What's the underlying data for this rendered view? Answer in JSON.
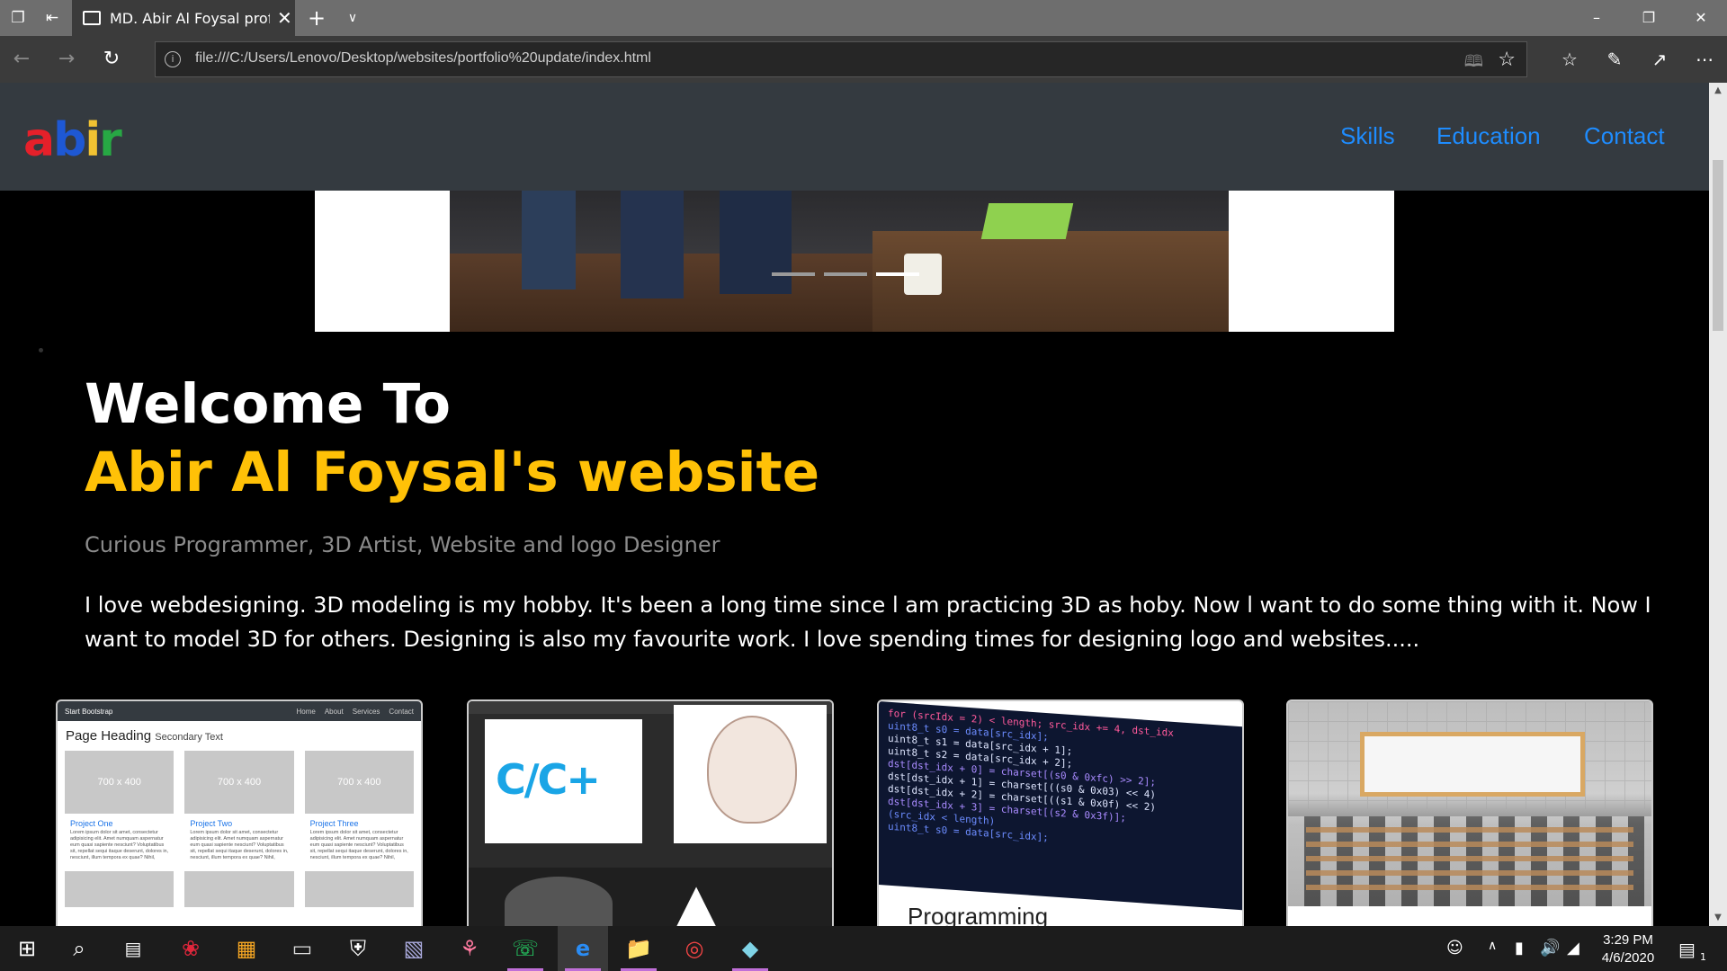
{
  "browser": {
    "tab_title": "MD. Abir Al Foysal profi",
    "url": "file:///C:/Users/Lenovo/Desktop/websites/portfolio%20update/index.html"
  },
  "site": {
    "logo_letters": [
      "a",
      "b",
      "i",
      "r"
    ],
    "nav": [
      "Skills",
      "Education",
      "Contact"
    ],
    "carousel": {
      "slide_count": 3,
      "active_slide": 3
    },
    "welcome": "Welcome To",
    "name": "Abir Al Foysal's website",
    "tagline": "Curious Programmer, 3D Artist, Website and logo Designer",
    "about": "I love webdesigning. 3D modeling is my hobby. It's been a long time since l am practicing 3D as hoby. Now l want to do some thing with it. Now I want to model 3D for others. Designing is also my favourite work. I love spending times for designing logo and websites.....",
    "cards": {
      "bootstrap": {
        "brand": "Start Bootstrap",
        "links": [
          "Home",
          "About",
          "Services",
          "Contact"
        ],
        "heading": "Page Heading",
        "subheading": "Secondary Text",
        "placeholder": "700 x 400",
        "projects": [
          "Project One",
          "Project Two",
          "Project Three"
        ],
        "lorem": "Lorem ipsum dolor sit amet, consectetur adipisicing elit. Amet numquam aspernatur eum quasi sapiente nesciunt? Voluptatibus sit, repellat sequi itaque deserunt, dolores in, nesciunt, illum tempora ex quae? Nihil, dolorem!"
      },
      "design": {
        "logo_text": "C/C+"
      },
      "code": {
        "lines": [
          "for (srcIdx = 2) < length; src_idx += 4, dst_idx",
          "  uint8_t s0 = data[src_idx];",
          "  uint8_t s1 = data[src_idx + 1];",
          "  uint8_t s2 = data[src_idx + 2];",
          "  dst[dst_idx + 0] = charset[(s0 & 0xfc) >> 2];",
          "  dst[dst_idx + 1] = charset[((s0 & 0x03) << 4)",
          "  dst[dst_idx + 2] = charset[((s1 & 0x0f) << 2)",
          "  dst[dst_idx + 3] = charset[(s2 & 0x3f)];",
          "(src_idx < length)",
          "  uint8_t s0 = data[src_idx];"
        ],
        "title": "Programming"
      }
    }
  },
  "taskbar": {
    "time": "3:29 PM",
    "date": "4/6/2020",
    "notification_count": "1"
  },
  "colors": {
    "accent_yellow": "#ffc107",
    "nav_blue": "#1e8cff",
    "header_bg": "#343a40"
  }
}
